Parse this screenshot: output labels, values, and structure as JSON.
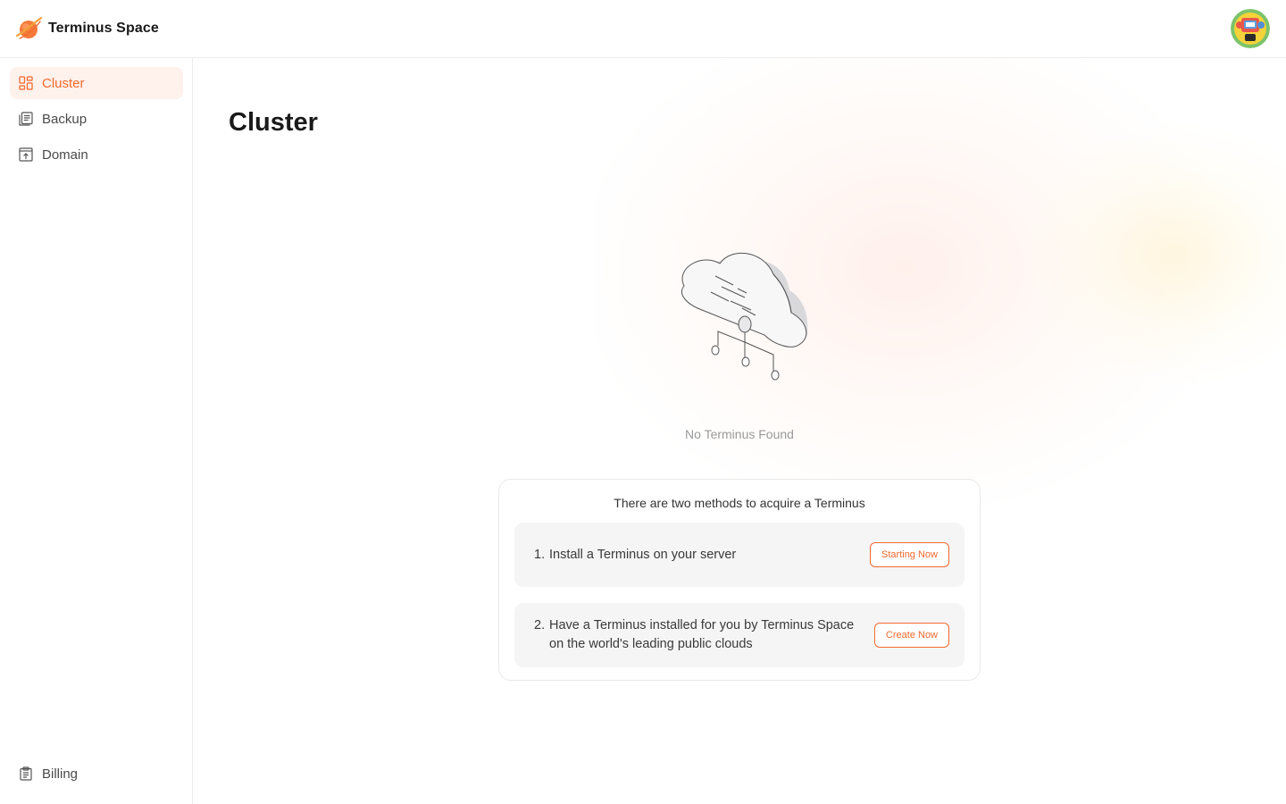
{
  "header": {
    "brand_name": "Terminus Space",
    "logo_icon": "planet-logo-icon",
    "avatar_icon": "user-avatar"
  },
  "colors": {
    "accent": "#f26a2e",
    "active_bg": "#fff1ec",
    "row_bg": "#f5f5f5"
  },
  "sidebar": {
    "items": [
      {
        "label": "Cluster",
        "icon": "dashboard-grid-icon",
        "active": true
      },
      {
        "label": "Backup",
        "icon": "backup-list-icon",
        "active": false
      },
      {
        "label": "Domain",
        "icon": "domain-upload-icon",
        "active": false
      }
    ],
    "bottom": {
      "label": "Billing",
      "icon": "billing-clipboard-icon"
    }
  },
  "main": {
    "title": "Cluster",
    "empty_icon": "cloud-network-icon",
    "empty_text": "No Terminus Found",
    "methods": {
      "title": "There are two methods to acquire a Terminus",
      "items": [
        {
          "num": "1.",
          "text": "Install a Terminus on your server",
          "button": "Starting Now"
        },
        {
          "num": "2.",
          "text": "Have a Terminus installed for you by Terminus Space on the world's leading public clouds",
          "button": "Create Now"
        }
      ]
    }
  }
}
